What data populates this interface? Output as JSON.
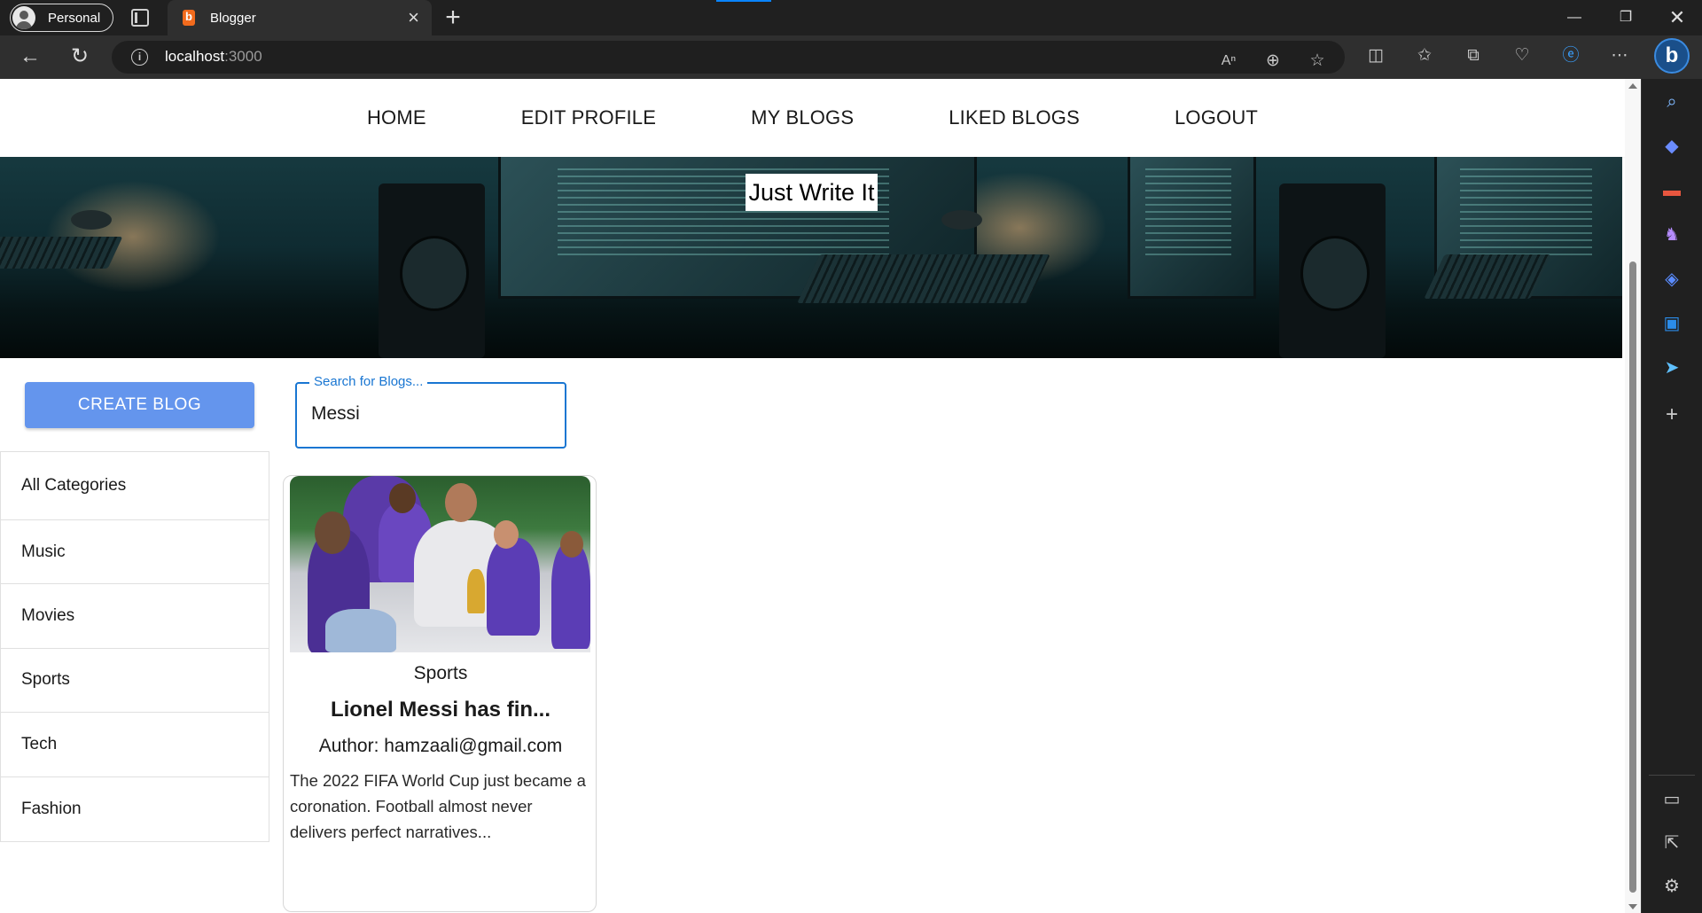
{
  "browser": {
    "profile": "Personal",
    "tab_title": "Blogger",
    "url_host": "localhost",
    "url_port": ":3000"
  },
  "nav": {
    "items": [
      "HOME",
      "EDIT PROFILE",
      "MY BLOGS",
      "LIKED BLOGS",
      "LOGOUT"
    ]
  },
  "hero": {
    "title": "Just Write It"
  },
  "actions": {
    "create_label": "CREATE BLOG"
  },
  "search": {
    "label": "Search for Blogs...",
    "value": "Messi"
  },
  "categories": [
    "All Categories",
    "Music",
    "Movies",
    "Sports",
    "Tech",
    "Fashion"
  ],
  "posts": [
    {
      "category": "Sports",
      "title": "Lionel Messi has fin...",
      "author": "Author: hamzaali@gmail.com",
      "excerpt": "The 2022 FIFA World Cup just became a coronation. Football almost never delivers perfect narratives..."
    }
  ],
  "colors": {
    "primary": "#6495ed",
    "focus": "#1976d2"
  }
}
